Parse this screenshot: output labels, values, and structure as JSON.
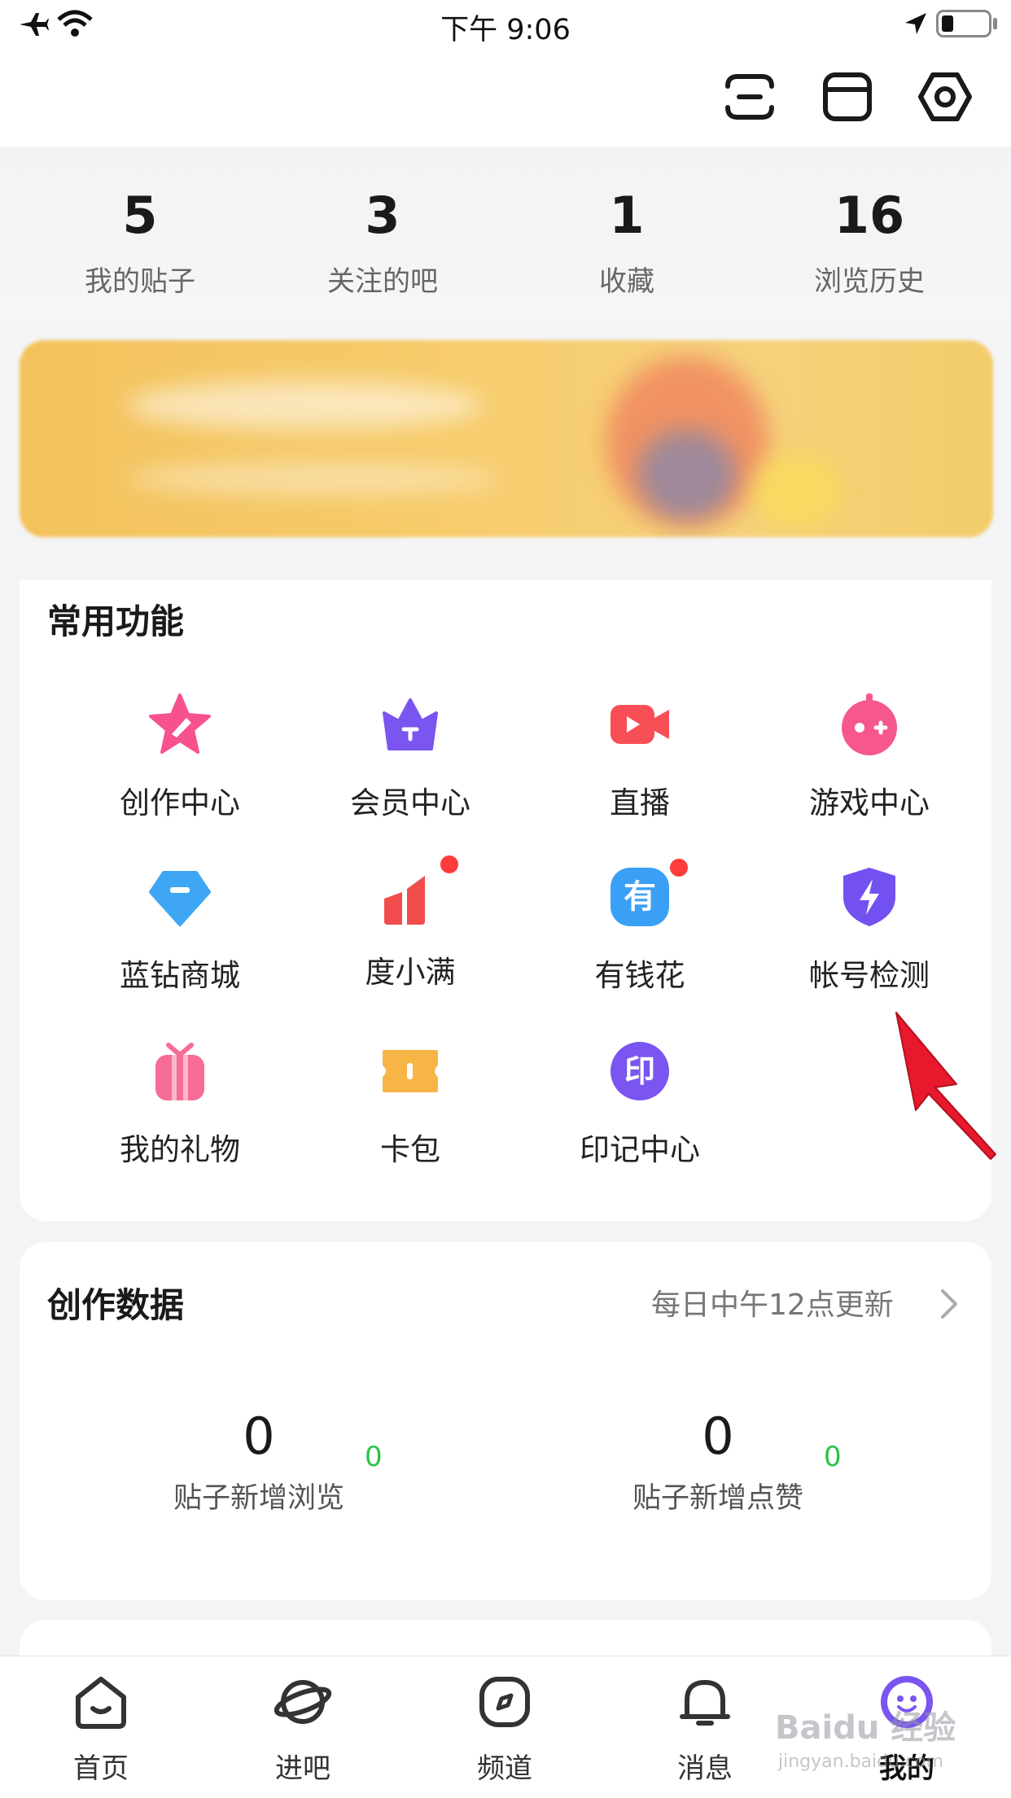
{
  "status_bar": {
    "time": "下午 9:06"
  },
  "header": {
    "icons": [
      "scan-icon",
      "mailbox-icon",
      "settings-hexagon-icon"
    ]
  },
  "stats": [
    {
      "value": "5",
      "label": "我的贴子"
    },
    {
      "value": "3",
      "label": "关注的吧"
    },
    {
      "value": "1",
      "label": "收藏"
    },
    {
      "value": "16",
      "label": "浏览历史"
    }
  ],
  "functions": {
    "title": "常用功能",
    "items": [
      {
        "label": "创作中心",
        "icon": "star-pen-icon",
        "color": "#f7528f"
      },
      {
        "label": "会员中心",
        "icon": "crown-icon",
        "color": "#7a55f0"
      },
      {
        "label": "直播",
        "icon": "video-camera-icon",
        "color": "#f74f55"
      },
      {
        "label": "游戏中心",
        "icon": "gamepad-icon",
        "color": "#f6578c"
      },
      {
        "label": "蓝钻商城",
        "icon": "diamond-icon",
        "color": "#3fa6f5"
      },
      {
        "label": "度小满",
        "icon": "bar-chart-icon",
        "color": "#f24d4d"
      },
      {
        "label": "有钱花",
        "icon": "you-badge-icon",
        "color": "#3aa0f5"
      },
      {
        "label": "帐号检测",
        "icon": "shield-bolt-icon",
        "color": "#7351f0"
      },
      {
        "label": "我的礼物",
        "icon": "gift-icon",
        "color": "#f66c95"
      },
      {
        "label": "卡包",
        "icon": "ticket-icon",
        "color": "#f7b545"
      },
      {
        "label": "印记中心",
        "icon": "seal-icon",
        "color": "#7a55f0"
      }
    ],
    "badge_color": "#ff3b3b",
    "icon_glyph_you": "有",
    "icon_glyph_seal": "印"
  },
  "creation_data": {
    "title": "创作数据",
    "update_note": "每日中午12点更新",
    "metrics": [
      {
        "value": "0",
        "label": "贴子新增浏览",
        "delta": "0"
      },
      {
        "value": "0",
        "label": "贴子新增点赞",
        "delta": "0"
      }
    ]
  },
  "bottom_nav": [
    {
      "label": "首页",
      "icon": "home-icon"
    },
    {
      "label": "进吧",
      "icon": "planet-icon"
    },
    {
      "label": "频道",
      "icon": "compass-icon"
    },
    {
      "label": "消息",
      "icon": "bell-icon"
    },
    {
      "label": "我的",
      "icon": "smiley-avatar-icon",
      "active": true
    }
  ],
  "watermark": {
    "brand": "Baidu 经验",
    "url": "jingyan.baidu.com"
  },
  "colors": {
    "accent": "#7a55f0",
    "positive": "#2bc34a",
    "arrow": "#e8192c"
  }
}
